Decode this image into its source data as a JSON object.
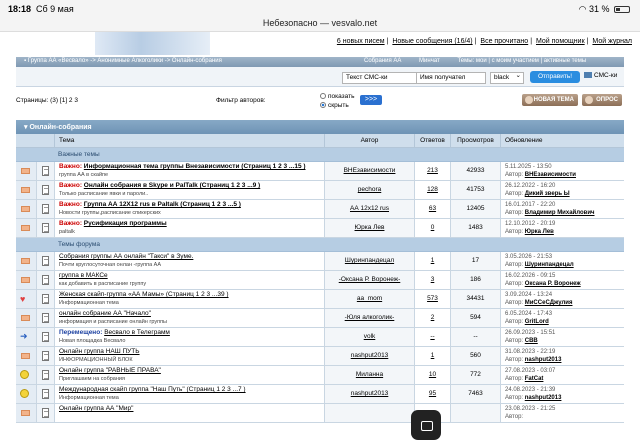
{
  "statusbar": {
    "time": "18:18",
    "date": "Сб 9 мая",
    "battery": "31 %"
  },
  "browser": {
    "url": "Небезопасно — vesvalo.net"
  },
  "toplinks": [
    "6 новых писем",
    "Новые сообщения (16/4)",
    "Все прочитано",
    "Мой помощник",
    "Мой журнал"
  ],
  "navbar": {
    "crumbs": "Группа АА «Весвало» -> Анонимные Алкоголики -> Онлайн-собрания",
    "tabs": [
      "Собрания АА",
      "Минчат",
      "Темы: мои | с моим участием | активные темы"
    ]
  },
  "sms": {
    "message_placeholder": "Текст СМС-ки",
    "name_placeholder": "Имя получател",
    "color": "black",
    "send": "Отправить!",
    "link": "СМС-ки"
  },
  "pager": {
    "label": "Страницы:",
    "current": "(3) [1] 2 3"
  },
  "filter": {
    "label": "Фильтр авторов:",
    "show": "показать",
    "hide": "скрыть",
    "go": ">>>"
  },
  "buttons": {
    "new_topic": "НОВАЯ ТЕМА",
    "poll": "ОПРОС"
  },
  "forum": {
    "title": "Онлайн-собрания",
    "columns": [
      "Тема",
      "Автор",
      "Ответов",
      "Просмотров",
      "Обновление"
    ],
    "important_label": "Важные темы",
    "forum_label": "Темы форума",
    "important": [
      {
        "icon": "envelope-icon",
        "prefix": "Важно:",
        "title": "Информационная тема группы Внезависимости (Страниц 1 2 3 ...15 )",
        "sub": "группа АА в скайпе",
        "author": "ВНЕзависимости",
        "replies": "213",
        "views": "42933",
        "date": "5.11.2025 - 13:50",
        "by": "ВНЕзависимости"
      },
      {
        "icon": "envelope-icon",
        "prefix": "Важно:",
        "title": "Онлайн собрания в Skype и PalTalk (Страниц 1 2 3 ...9 )",
        "sub": "Только расписание явки и пароли..",
        "author": "pechora",
        "replies": "128",
        "views": "41753",
        "date": "26.12.2022 - 16:20",
        "by": "Дикий зверь Ы"
      },
      {
        "icon": "envelope-icon",
        "prefix": "Важно:",
        "title": "Группа АА 12X12 rus в Paltalk (Страниц 1 2 3 ...5 )",
        "sub": "Новости группы,расписание спикерских",
        "author": "АА 12x12 rus",
        "replies": "63",
        "views": "12405",
        "date": "16.01.2017 - 22:20",
        "by": "Владимир Михайлович"
      },
      {
        "icon": "envelope-icon",
        "prefix": "Важно:",
        "title": "Русификация программы",
        "sub": "paltalk",
        "author": "Юрка Лев",
        "replies": "0",
        "views": "1483",
        "date": "12.10.2012 - 20:19",
        "by": "Юрка Лев"
      }
    ],
    "topics": [
      {
        "icon": "envelope-icon",
        "prefix": "",
        "title": "Собрания группы АА онлайн \"Такси\" в Зуме.",
        "sub": "Почти круглосуточная онлан -группа АА",
        "author": "Шуринпандецал",
        "replies": "1",
        "views": "17",
        "date": "3.05.2026 - 21:53",
        "by": "Шуринпандецал"
      },
      {
        "icon": "envelope-icon",
        "prefix": "",
        "title": "группа в МАКСе",
        "sub": "как добавить в расписание группу",
        "author": "-Оксана Р. Воронеж-",
        "replies": "3",
        "views": "186",
        "date": "16.02.2026 - 09:15",
        "by": "Оксана Р. Воронеж"
      },
      {
        "icon": "heart-icon",
        "prefix": "",
        "title": "Женская скайп-группа «АА Мамы» (Страниц 1 2 3 ...39 )",
        "sub": "Информационная тема",
        "author": "aa_mom",
        "replies": "573",
        "views": "34431",
        "date": "3.09.2024 - 13:24",
        "by": "МиССеСДжулия"
      },
      {
        "icon": "envelope-icon",
        "prefix": "",
        "title": "онлайн собрание АА \"Начало\"",
        "sub": "информация и расписание онлайн группы",
        "author": "-Юля алкоголик-",
        "replies": "2",
        "views": "594",
        "date": "6.05.2024 - 17:43",
        "by": "GritLord"
      },
      {
        "icon": "arrow-icon",
        "prefix": "Перемещено:",
        "title": "Весвало в Телеграмм",
        "sub": "Новая площадка Весвало",
        "author": "volk",
        "replies": "--",
        "views": "--",
        "date": "26.09.2023 - 15:51",
        "by": "CBB"
      },
      {
        "icon": "envelope-icon",
        "prefix": "",
        "title": "Онлайн группа НАШ ПУТЬ",
        "sub": "ИНФОРМАЦИОННЫЙ БЛОК",
        "author": "nashput2013",
        "replies": "1",
        "views": "560",
        "date": "31.08.2023 - 22:19",
        "by": "nashput2013"
      },
      {
        "icon": "smile-icon",
        "prefix": "",
        "title": "Онлайн группа \"РАВНЫЕ ПРАВА\"",
        "sub": "Приглашаем на собрания",
        "author": "Миланна",
        "replies": "10",
        "views": "772",
        "date": "27.08.2023 - 03:07",
        "by": "FatCat"
      },
      {
        "icon": "smile-icon",
        "prefix": "",
        "title": "Международная скайп группа \"Наш Путь\" (Страниц 1 2 3 ...7 )",
        "sub": "Информационная тема",
        "author": "nashput2013",
        "replies": "95",
        "views": "7463",
        "date": "24.08.2023 - 21:39",
        "by": "nashput2013"
      },
      {
        "icon": "envelope-icon",
        "prefix": "",
        "title": "Онлайн группа АА \"Мир\"",
        "sub": "",
        "author": "",
        "replies": "",
        "views": "",
        "date": "23.08.2023 - 21:25",
        "by": ""
      }
    ]
  }
}
